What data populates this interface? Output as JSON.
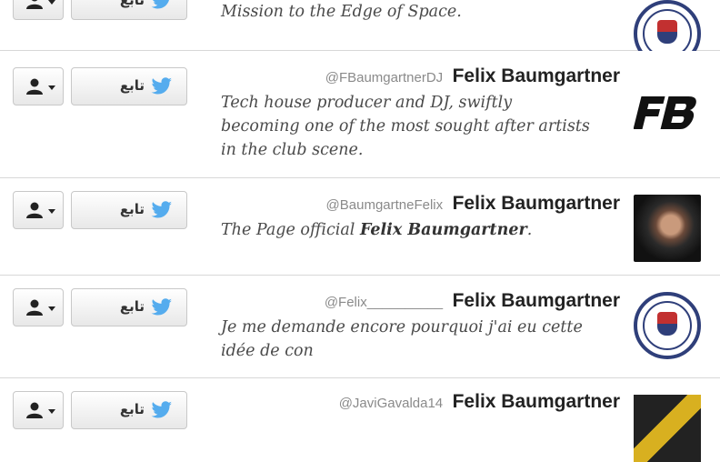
{
  "follow_label": "تابع",
  "rows": [
    {
      "handle": "",
      "name": "",
      "bio_lines": [
        "Mission to the Edge of Space."
      ],
      "avatar": "seal-emblem-icon"
    },
    {
      "handle": "@FBaumgartnerDJ",
      "name": "Felix Baumgartner",
      "bio_lines": [
        "Tech house producer and DJ, swiftly",
        "becoming one of the most sought after artists",
        "in the club scene."
      ],
      "avatar": "fb-logo-icon"
    },
    {
      "handle": "@BaumgartneFelix",
      "name": "Felix Baumgartner",
      "bio_prefix": "The Page official ",
      "bio_bold": "Felix Baumgartner",
      "bio_suffix": ".",
      "avatar": "astronaut-photo"
    },
    {
      "handle": "@Felix__________",
      "name": "Felix Baumgartner",
      "bio_lines": [
        "Je me demande encore pourquoi j'ai eu cette",
        "idée de con"
      ],
      "avatar": "seal-emblem-icon"
    },
    {
      "handle": "@JaviGavalda14",
      "name": "Felix Baumgartner",
      "bio_lines": [],
      "avatar": "partial-avatar"
    }
  ],
  "colors": {
    "twitter_blue": "#55acee",
    "seal_blue": "#2f3f7a",
    "seal_red": "#c23030",
    "border": "#d8d8d8"
  }
}
